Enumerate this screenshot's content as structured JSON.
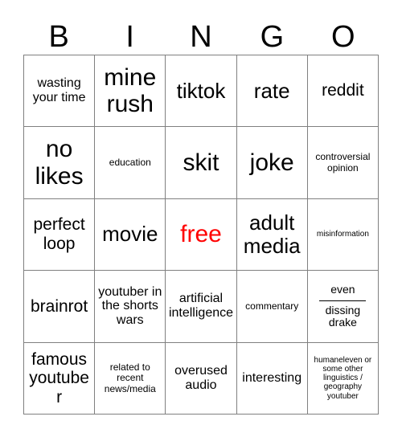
{
  "card": {
    "title": "BINGO",
    "header_letters": [
      "B",
      "I",
      "N",
      "G",
      "O"
    ],
    "free_color": "#ff0000",
    "grid_line_color": "#808080",
    "text_color": "#000000",
    "background": "#ffffff"
  },
  "cells": [
    {
      "id": "b1",
      "text": "wasting your time",
      "size": "sm"
    },
    {
      "id": "i1",
      "text": "mine rush",
      "size": "xl"
    },
    {
      "id": "n1",
      "text": "tiktok",
      "size": "lg"
    },
    {
      "id": "g1",
      "text": "rate",
      "size": "lg"
    },
    {
      "id": "o1",
      "text": "reddit",
      "size": "md"
    },
    {
      "id": "b2",
      "text": "no likes",
      "size": "xl"
    },
    {
      "id": "i2",
      "text": "education",
      "size": "xs"
    },
    {
      "id": "n2",
      "text": "skit",
      "size": "xl"
    },
    {
      "id": "g2",
      "text": "joke",
      "size": "xl"
    },
    {
      "id": "o2",
      "text": "controversial opinion",
      "size": "xs"
    },
    {
      "id": "b3",
      "text": "perfect loop",
      "size": "md"
    },
    {
      "id": "i3",
      "text": "movie",
      "size": "lg"
    },
    {
      "id": "n3",
      "text": "free",
      "size": "xl",
      "free": true
    },
    {
      "id": "g3",
      "text": "adult media",
      "size": "lg"
    },
    {
      "id": "o3",
      "text": "misinformation",
      "size": "xxs"
    },
    {
      "id": "b4",
      "text": "brainrot",
      "size": "md"
    },
    {
      "id": "i4",
      "text": "youtuber in the shorts wars",
      "size": "sm"
    },
    {
      "id": "n4",
      "text": "artificial intelligence",
      "size": "sm"
    },
    {
      "id": "g4",
      "text": "commentary",
      "size": "xs"
    },
    {
      "id": "o4",
      "fraction": {
        "top": "even",
        "bottom": "dissing drake"
      },
      "size": "sm"
    },
    {
      "id": "b5",
      "text": "famous youtuber",
      "size": "md"
    },
    {
      "id": "i5",
      "text": "related to recent news/media",
      "size": "xs"
    },
    {
      "id": "n5",
      "text": "overused audio",
      "size": "sm"
    },
    {
      "id": "g5",
      "text": "interesting",
      "size": "sm"
    },
    {
      "id": "o5",
      "text": "humaneleven or some other linguistics / geography youtuber",
      "size": "xxs"
    }
  ]
}
